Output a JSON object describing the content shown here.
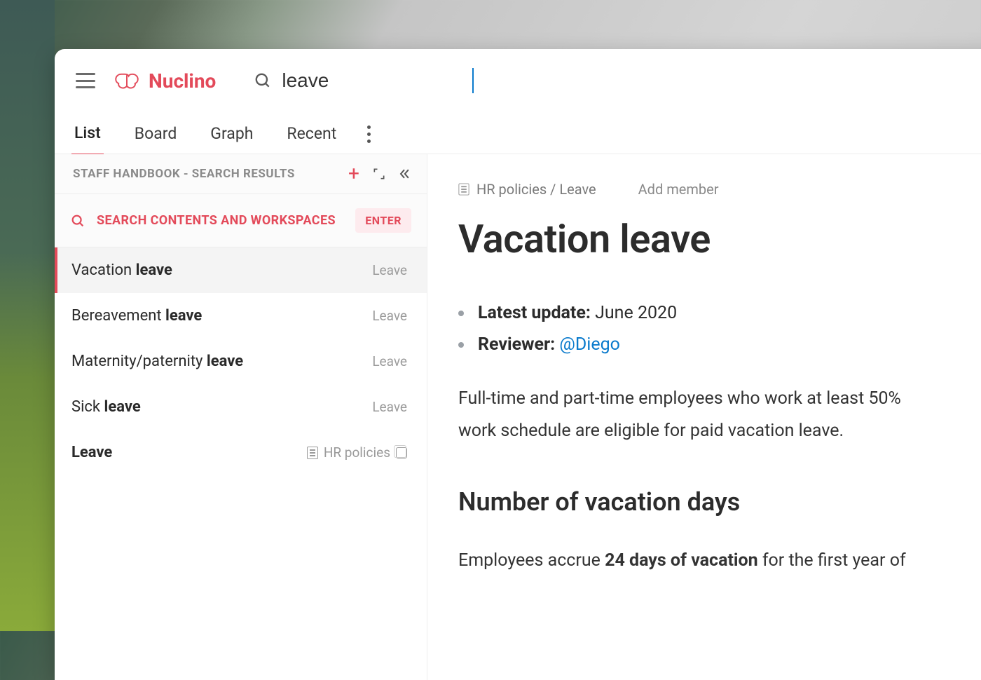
{
  "brand": {
    "name": "Nuclino"
  },
  "search": {
    "query": "leave"
  },
  "tabs": {
    "list": "List",
    "board": "Board",
    "graph": "Graph",
    "recent": "Recent",
    "active": "list"
  },
  "sidebar": {
    "header": "STAFF HANDBOOK - SEARCH RESULTS",
    "cta_label": "SEARCH CONTENTS AND WORKSPACES",
    "cta_key": "ENTER",
    "results": [
      {
        "pre": "Vacation ",
        "match": "leave",
        "category": "Leave",
        "selected": true
      },
      {
        "pre": "Bereavement ",
        "match": "leave",
        "category": "Leave",
        "selected": false
      },
      {
        "pre": "Maternity/paternity ",
        "match": "leave",
        "category": "Leave",
        "selected": false
      },
      {
        "pre": "Sick ",
        "match": "leave",
        "category": "Leave",
        "selected": false
      }
    ],
    "collection_result": {
      "title": "Leave",
      "category": "HR policies"
    }
  },
  "content": {
    "breadcrumb": "HR policies / Leave",
    "add_member": "Add member",
    "title": "Vacation leave",
    "meta_update_label": "Latest update:",
    "meta_update_value": "June 2020",
    "meta_reviewer_label": "Reviewer:",
    "meta_reviewer_value": "@Diego",
    "paragraph_1a": "Full-time and part-time employees who work at least 50%",
    "paragraph_1b": "work schedule are eligible for paid vacation leave.",
    "h2": "Number of vacation days",
    "paragraph_2a": "Employees accrue ",
    "paragraph_2b": "24 days of vacation",
    "paragraph_2c": " for the first year of"
  }
}
